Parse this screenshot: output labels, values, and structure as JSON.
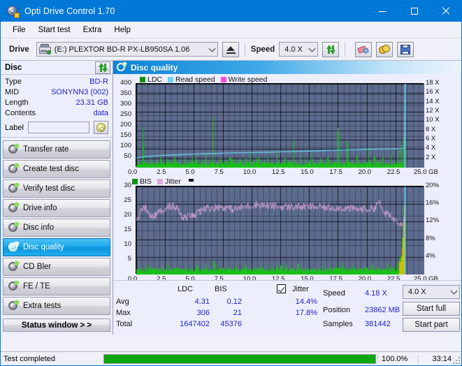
{
  "window": {
    "title": "Opti Drive Control 1.70",
    "icon": "disc-icon",
    "minimize": "minimize",
    "maximize": "maximize",
    "close": "close"
  },
  "menu": {
    "items": [
      "File",
      "Start test",
      "Extra",
      "Help"
    ]
  },
  "toolbar": {
    "drive_label": "Drive",
    "drive_value": "(E:)   PLEXTOR BD-R  PX-LB950SA 1.06",
    "eject": "eject",
    "speed_label": "Speed",
    "speed_value": "4.0 X",
    "refresh": "refresh",
    "erase": "erase",
    "cookie": "cookie",
    "save": "save"
  },
  "disc_panel": {
    "title": "Disc",
    "refresh_button": "refresh",
    "rows": [
      {
        "key": "Type",
        "value": "BD-R"
      },
      {
        "key": "MID",
        "value": "SONYNN3 (002)"
      },
      {
        "key": "Length",
        "value": "23.31 GB"
      },
      {
        "key": "Contents",
        "value": "data"
      }
    ],
    "label_key": "Label",
    "label_value": "",
    "label_placeholder": ""
  },
  "nav": {
    "items": [
      {
        "label": "Transfer rate",
        "active": false
      },
      {
        "label": "Create test disc",
        "active": false
      },
      {
        "label": "Verify test disc",
        "active": false
      },
      {
        "label": "Drive info",
        "active": false
      },
      {
        "label": "Disc info",
        "active": false
      },
      {
        "label": "Disc quality",
        "active": true
      },
      {
        "label": "CD Bler",
        "active": false
      },
      {
        "label": "FE / TE",
        "active": false
      },
      {
        "label": "Extra tests",
        "active": false
      }
    ],
    "status_window": "Status window > >"
  },
  "panel": {
    "title": "Disc quality"
  },
  "stats": {
    "col_ldc": "LDC",
    "col_bis": "BIS",
    "jitter_label": "Jitter",
    "jitter_checked": true,
    "rows": [
      {
        "key": "Avg",
        "ldc": "4.31",
        "bis": "0.12",
        "jitter": "14.4%"
      },
      {
        "key": "Max",
        "ldc": "306",
        "bis": "21",
        "jitter": "17.8%"
      },
      {
        "key": "Total",
        "ldc": "1647402",
        "bis": "45376",
        "jitter": ""
      }
    ],
    "speed_key": "Speed",
    "speed_value": "4.18 X",
    "position_key": "Position",
    "position_value": "23862 MB",
    "samples_key": "Samples",
    "samples_value": "381442",
    "speed_select": "4.0 X",
    "start_full": "Start full",
    "start_part": "Start part"
  },
  "statusbar": {
    "text": "Test completed",
    "percent": "100.0%",
    "progress": 100,
    "time": "33:14"
  },
  "colors": {
    "accent": "#0078d7",
    "plot_bg": "#5d6c8e",
    "grid": "#2b3042",
    "ldc": "#18c018",
    "bis": "#18c018",
    "read_speed": "#6ad2f5",
    "write_speed": "#ff4fd8",
    "jitter": "#e0a8de",
    "value_text": "#2222cc",
    "progress": "#0ba60b"
  },
  "chart_data": [
    {
      "type": "area",
      "title": "Disc quality - LDC / speed",
      "legend": [
        {
          "label": "LDC",
          "color": "#149014"
        },
        {
          "label": "Read speed",
          "color": "#6ad2f5"
        },
        {
          "label": "Write speed",
          "color": "#ff4fd8"
        }
      ],
      "legend_position": "top-left",
      "xlabel": "GB",
      "ylabel": "LDC",
      "y2label": "X",
      "xlim": [
        0,
        25
      ],
      "ylim": [
        0,
        400
      ],
      "y2lim": [
        0,
        18
      ],
      "xticks": [
        "0.0",
        "2.5",
        "5.0",
        "7.5",
        "10.0",
        "12.5",
        "15.0",
        "17.5",
        "20.0",
        "22.5",
        "25.0 GB"
      ],
      "yticks": [
        50,
        100,
        150,
        200,
        250,
        300,
        350,
        400
      ],
      "y2ticks": [
        "2 X",
        "4 X",
        "6 X",
        "8 X",
        "10 X",
        "12 X",
        "14 X",
        "16 X",
        "18 X"
      ],
      "grid": true,
      "data_end_gb": 23.3,
      "series": [
        {
          "name": "LDC",
          "type": "spike-area",
          "baseline": 10,
          "noise": 22,
          "spikes": [
            [
              0.55,
              198
            ],
            [
              0.62,
              120
            ],
            [
              1.2,
              58
            ],
            [
              2.1,
              64
            ],
            [
              2.6,
              52
            ],
            [
              3.3,
              70
            ],
            [
              4.2,
              55
            ],
            [
              5.1,
              60
            ],
            [
              6.0,
              74
            ],
            [
              6.6,
              268
            ],
            [
              7.3,
              58
            ],
            [
              8.1,
              66
            ],
            [
              9.0,
              52
            ],
            [
              9.9,
              82
            ],
            [
              10.6,
              60
            ],
            [
              11.4,
              58
            ],
            [
              12.2,
              70
            ],
            [
              12.9,
              64
            ],
            [
              13.6,
              144
            ],
            [
              14.2,
              60
            ],
            [
              15.1,
              70
            ],
            [
              16.0,
              56
            ],
            [
              16.6,
              68
            ],
            [
              17.5,
              232
            ],
            [
              18.3,
              158
            ],
            [
              19.1,
              72
            ],
            [
              20.1,
              112
            ],
            [
              20.6,
              72
            ],
            [
              21.4,
              66
            ],
            [
              22.1,
              70
            ],
            [
              22.7,
              84
            ],
            [
              23.0,
              110
            ],
            [
              23.2,
              170
            ]
          ]
        },
        {
          "name": "Read speed",
          "type": "line",
          "unit": "X",
          "points": [
            [
              0.0,
              2.0
            ],
            [
              0.3,
              2.2
            ],
            [
              0.6,
              2.3
            ],
            [
              1.0,
              2.4
            ],
            [
              1.5,
              2.5
            ],
            [
              2.2,
              2.6
            ],
            [
              3.0,
              2.7
            ],
            [
              4.0,
              2.8
            ],
            [
              5.0,
              2.9
            ],
            [
              6.2,
              3.0
            ],
            [
              7.5,
              3.1
            ],
            [
              8.8,
              3.2
            ],
            [
              10.0,
              3.25
            ],
            [
              11.2,
              3.3
            ],
            [
              12.5,
              3.4
            ],
            [
              14.0,
              3.5
            ],
            [
              15.4,
              3.6
            ],
            [
              16.8,
              3.7
            ],
            [
              18.0,
              3.8
            ],
            [
              19.5,
              3.9
            ],
            [
              21.0,
              4.0
            ],
            [
              22.5,
              4.05
            ],
            [
              23.3,
              4.1
            ],
            [
              23.35,
              18.0
            ]
          ]
        },
        {
          "name": "Write speed",
          "type": "line",
          "points": []
        }
      ]
    },
    {
      "type": "area",
      "title": "Disc quality - BIS / jitter",
      "legend": [
        {
          "label": "BIS",
          "color": "#149014"
        },
        {
          "label": "Jitter",
          "color": "#e0a8de"
        }
      ],
      "legend_position": "top-left",
      "xlabel": "GB",
      "ylabel": "BIS",
      "y2label": "%",
      "xlim": [
        0,
        25
      ],
      "ylim": [
        0,
        30
      ],
      "y2lim": [
        0,
        20
      ],
      "xticks": [
        "0.0",
        "2.5",
        "5.0",
        "7.5",
        "10.0",
        "12.5",
        "15.0",
        "17.5",
        "20.0",
        "22.5",
        "25.0 GB"
      ],
      "yticks": [
        5,
        10,
        15,
        20,
        25,
        30
      ],
      "y2ticks": [
        "4%",
        "8%",
        "12%",
        "16%",
        "20%"
      ],
      "grid": true,
      "data_end_gb": 23.3,
      "series": [
        {
          "name": "BIS",
          "type": "spike-area",
          "baseline": 1.0,
          "noise": 1.4,
          "spikes": [
            [
              2.6,
              4.0
            ],
            [
              5.2,
              4.6
            ],
            [
              6.7,
              6.0
            ],
            [
              9.4,
              3.6
            ],
            [
              12.6,
              4.2
            ],
            [
              13.0,
              4.0
            ],
            [
              17.4,
              4.4
            ],
            [
              20.5,
              3.4
            ],
            [
              22.6,
              5.0
            ],
            [
              22.9,
              8.0
            ],
            [
              23.05,
              13.5
            ],
            [
              23.2,
              21.0
            ]
          ]
        },
        {
          "name": "Jitter",
          "type": "noisy-line",
          "unit": "%",
          "points": [
            [
              0.0,
              12.2
            ],
            [
              0.4,
              14.6
            ],
            [
              0.8,
              15.2
            ],
            [
              1.2,
              13.0
            ],
            [
              1.6,
              13.4
            ],
            [
              2.2,
              14.6
            ],
            [
              2.8,
              15.6
            ],
            [
              3.4,
              15.4
            ],
            [
              4.0,
              12.8
            ],
            [
              4.6,
              13.2
            ],
            [
              5.2,
              13.6
            ],
            [
              5.8,
              15.0
            ],
            [
              6.6,
              15.2
            ],
            [
              7.4,
              15.4
            ],
            [
              8.4,
              14.8
            ],
            [
              9.4,
              15.4
            ],
            [
              10.4,
              16.0
            ],
            [
              11.4,
              15.6
            ],
            [
              12.4,
              15.4
            ],
            [
              13.4,
              15.4
            ],
            [
              14.4,
              15.4
            ],
            [
              15.4,
              15.4
            ],
            [
              16.4,
              15.2
            ],
            [
              17.4,
              15.2
            ],
            [
              18.4,
              15.0
            ],
            [
              19.4,
              14.8
            ],
            [
              20.6,
              15.0
            ],
            [
              21.0,
              16.6
            ],
            [
              21.4,
              14.2
            ],
            [
              22.0,
              13.2
            ],
            [
              22.6,
              12.2
            ],
            [
              23.0,
              11.8
            ],
            [
              23.25,
              12.6
            ]
          ]
        }
      ]
    }
  ]
}
